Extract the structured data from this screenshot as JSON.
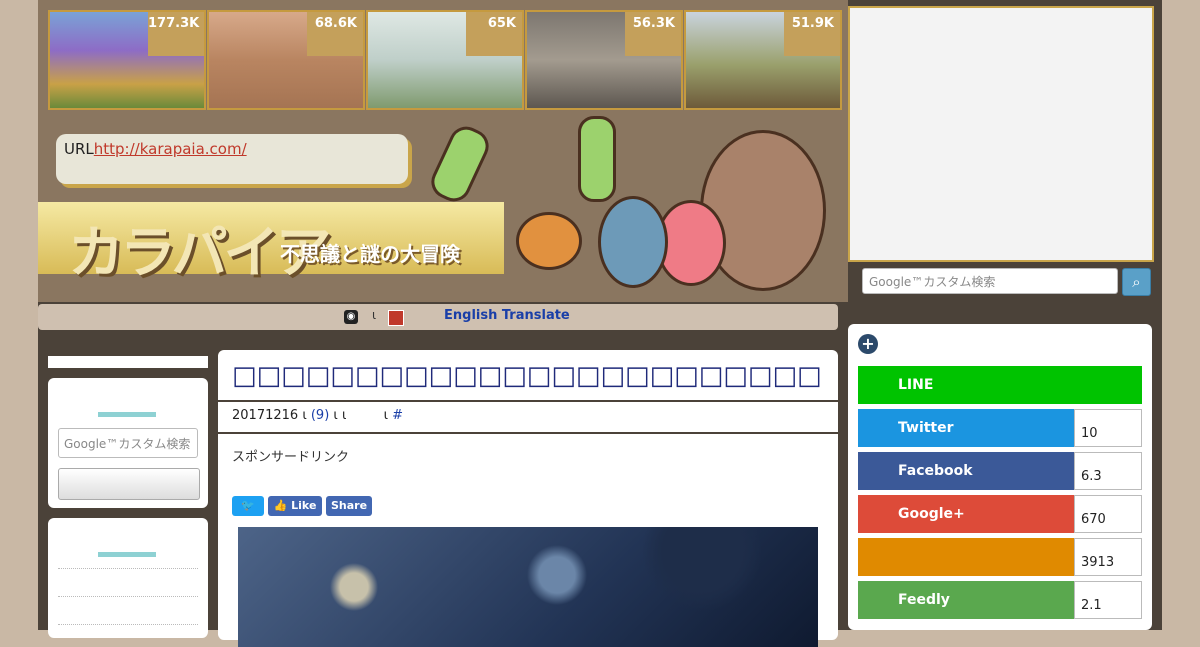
{
  "thumbnails": [
    {
      "count": "177.3K",
      "image": "purple-tree"
    },
    {
      "count": "68.6K",
      "image": "cats-on-rug"
    },
    {
      "count": "65K",
      "image": "tent-greenhouse"
    },
    {
      "count": "56.3K",
      "image": "rocky-ruins"
    },
    {
      "count": "51.9K",
      "image": "camera-landscape"
    }
  ],
  "header": {
    "url_label": "URL",
    "url_link": "http://karapaia.com/",
    "logo": "カラパイア",
    "tagline": "不思議と謎の大冒険"
  },
  "translate": {
    "separator": "ι",
    "label": "English Translate"
  },
  "search": {
    "placeholder": "Google™カスタム検索"
  },
  "sidebar_left": {
    "search_placeholder": "Google™カスタム検索"
  },
  "article": {
    "title": "□□□□□□□□□□□□□□□□□□□□□□□□□□□□□□□□□□□□□□",
    "meta_date": "20171216",
    "meta_sep1": "ι",
    "meta_comments": "(9)",
    "meta_rest": "ι ι",
    "meta_sep2": "ι",
    "meta_hash": "#",
    "sponsor": "スポンサードリンク"
  },
  "social_buttons": {
    "like": "Like",
    "share": "Share"
  },
  "share_panel": {
    "items": [
      {
        "label": "LINE",
        "count": "",
        "color": "#00c300"
      },
      {
        "label": "Twitter",
        "count": "10",
        "color": "#1b95e0"
      },
      {
        "label": "Facebook",
        "count": "6.3",
        "color": "#3b5998"
      },
      {
        "label": "Google+",
        "count": "670",
        "color": "#dd4b39"
      },
      {
        "label": "",
        "count": "3913",
        "color": "#e08a00"
      },
      {
        "label": "Feedly",
        "count": "2.1",
        "color": "#5aa84e"
      }
    ]
  }
}
